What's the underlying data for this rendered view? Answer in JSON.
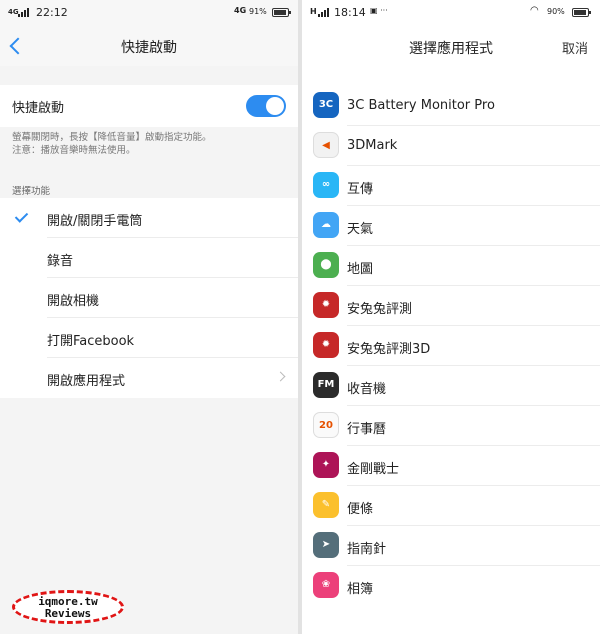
{
  "left": {
    "status": {
      "network": "4G",
      "time": "22:12",
      "net_type": "4G",
      "battery": "91%",
      "battery_level": 0.91
    },
    "nav": {
      "title": "快捷啟動"
    },
    "toggle": {
      "label": "快捷啟動",
      "enabled": true
    },
    "description": {
      "line1": "螢幕關閉時，長按【降低音量】啟動指定功能。",
      "line2": "注意：播放音樂時無法使用。"
    },
    "section_label": "選擇功能",
    "options": [
      {
        "label": "開啟/關閉手電筒",
        "selected": true
      },
      {
        "label": "錄音",
        "selected": false
      },
      {
        "label": "開啟相機",
        "selected": false
      },
      {
        "label": "打開Facebook",
        "selected": false
      },
      {
        "label": "開啟應用程式",
        "selected": false,
        "has_arrow": true
      }
    ],
    "watermark": {
      "line1": "iqmore.tw",
      "line2": "Reviews",
      "color": "#e01515"
    }
  },
  "right": {
    "status": {
      "network": "H",
      "time": "18:14",
      "extra": "▣ ···",
      "battery": "90%",
      "battery_level": 0.9
    },
    "nav": {
      "title": "選擇應用程式",
      "cancel": "取消"
    },
    "apps": [
      {
        "name": "3C Battery Monitor Pro",
        "icon": "3c-battery-icon",
        "glyph": "3C",
        "color": "#1565c0"
      },
      {
        "name": "3DMark",
        "icon": "3dmark-icon",
        "glyph": "◀",
        "color": "#f2f2f2"
      },
      {
        "name": "互傳",
        "icon": "transfer-icon",
        "glyph": "∞",
        "color": "#29b6f6"
      },
      {
        "name": "天氣",
        "icon": "weather-icon",
        "glyph": "☁",
        "color": "#42a5f5"
      },
      {
        "name": "地圖",
        "icon": "maps-icon",
        "glyph": "⬤",
        "color": "#4caf50"
      },
      {
        "name": "安兔兔評測",
        "icon": "antutu-icon",
        "glyph": "✹",
        "color": "#c62828"
      },
      {
        "name": "安兔兔評測3D",
        "icon": "antutu-3d-icon",
        "glyph": "✹",
        "color": "#c62828"
      },
      {
        "name": "收音機",
        "icon": "radio-icon",
        "glyph": "FM",
        "color": "#2b2b2b"
      },
      {
        "name": "行事曆",
        "icon": "calendar-icon",
        "glyph": "20",
        "color": "#fafafa"
      },
      {
        "name": "金剛戰士",
        "icon": "power-rangers-icon",
        "glyph": "✦",
        "color": "#ad1457"
      },
      {
        "name": "便條",
        "icon": "notes-icon",
        "glyph": "✎",
        "color": "#fbc02d"
      },
      {
        "name": "指南針",
        "icon": "compass-icon",
        "glyph": "➤",
        "color": "#546e7a"
      },
      {
        "name": "相簿",
        "icon": "gallery-icon",
        "glyph": "❀",
        "color": "#ec407a"
      }
    ]
  },
  "colors": {
    "accent": "#2d8cf0",
    "divider": "#e2e2e2"
  }
}
